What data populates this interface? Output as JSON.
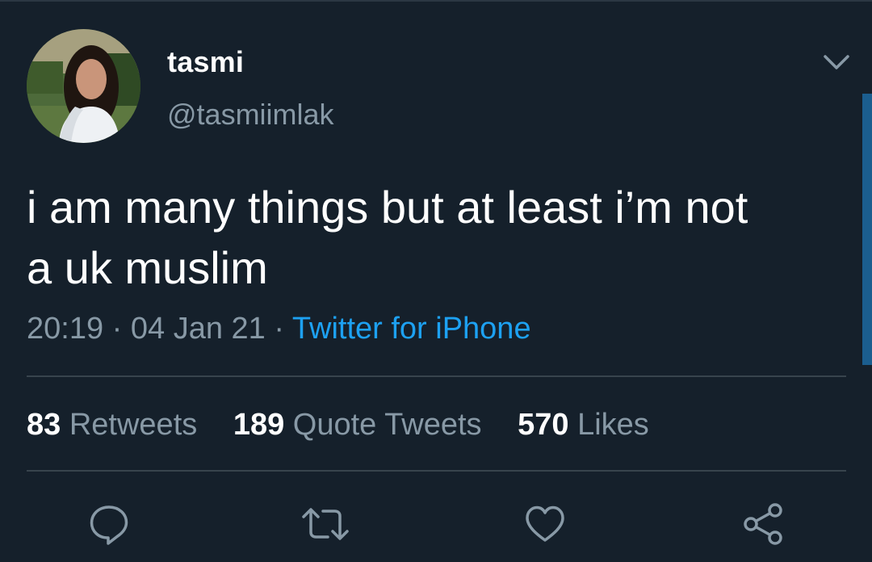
{
  "tweet": {
    "author": {
      "display_name": "tasmi",
      "handle": "@tasmiimlak"
    },
    "text": "i am many things but at least i’m not\na uk muslim",
    "time": "20:19",
    "date": "04 Jan 21",
    "separator": "·",
    "source": "Twitter for iPhone"
  },
  "stats": {
    "retweets_count": "83",
    "retweets_label": "Retweets",
    "quotes_count": "189",
    "quotes_label": "Quote Tweets",
    "likes_count": "570",
    "likes_label": "Likes"
  },
  "icons": {
    "more": "chevron-down-icon",
    "reply": "reply-icon",
    "retweet": "retweet-icon",
    "like": "heart-icon",
    "share": "share-icon"
  },
  "colors": {
    "background": "#15202b",
    "secondary_text": "#8899a6",
    "link": "#1da1f2",
    "divider": "#38444d"
  }
}
